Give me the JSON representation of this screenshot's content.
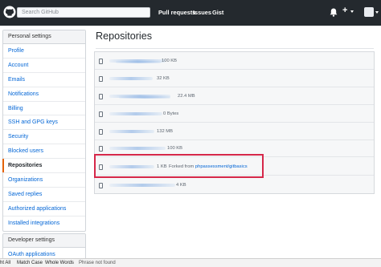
{
  "header": {
    "search_placeholder": "Search GitHub",
    "nav": [
      "Pull requests",
      "Issues",
      "Gist"
    ],
    "plus": "+"
  },
  "sidebar": {
    "title": "Personal settings",
    "items": [
      {
        "label": "Profile"
      },
      {
        "label": "Account"
      },
      {
        "label": "Emails"
      },
      {
        "label": "Notifications"
      },
      {
        "label": "Billing"
      },
      {
        "label": "SSH and GPG keys"
      },
      {
        "label": "Security"
      },
      {
        "label": "Blocked users"
      },
      {
        "label": "Repositories",
        "selected": true
      },
      {
        "label": "Organizations"
      },
      {
        "label": "Saved replies"
      },
      {
        "label": "Authorized applications"
      },
      {
        "label": "Installed integrations"
      }
    ]
  },
  "developer": {
    "title": "Developer settings",
    "items": [
      {
        "label": "OAuth applications"
      }
    ]
  },
  "main": {
    "title": "Repositories",
    "repos": [
      {
        "size": "100 KB"
      },
      {
        "size": "32 KB"
      },
      {
        "size": "22.4 MB"
      },
      {
        "size": "0 Bytes"
      },
      {
        "size": "132 MB"
      },
      {
        "size": "100 KB"
      },
      {
        "size": "1 KB",
        "forked_text": "Forked from",
        "forked_link": "phpassessment/gitbasics"
      },
      {
        "size": "4 KB"
      }
    ]
  },
  "findbar": {
    "highlight_all": "ht All",
    "match_case": "Match Case",
    "whole_words": "Whole Words",
    "status": "Phrase not found"
  },
  "colors": {
    "header_bg": "#24292e",
    "link": "#0366d6",
    "selected_marker": "#e36209",
    "annotation_box": "#d6284a"
  }
}
